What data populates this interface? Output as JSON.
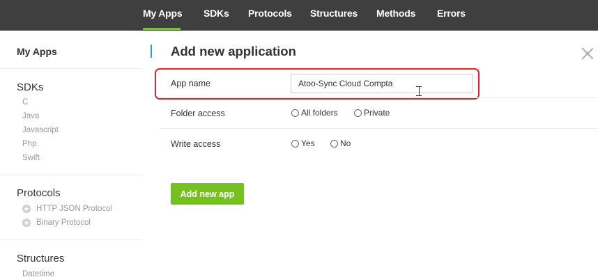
{
  "nav": {
    "items": [
      "My Apps",
      "SDKs",
      "Protocols",
      "Structures",
      "Methods",
      "Errors"
    ],
    "active": "My Apps"
  },
  "sidebar": {
    "my_apps": "My Apps",
    "sdks": {
      "heading": "SDKs",
      "items": [
        "C",
        "Java",
        "Javascript",
        "Php",
        "Swift"
      ]
    },
    "protocols": {
      "heading": "Protocols",
      "items": [
        "HTTP JSON Protocol",
        "Binary Protocol"
      ]
    },
    "structures": {
      "heading": "Structures",
      "items": [
        "Datetime"
      ]
    }
  },
  "form": {
    "title": "Add new application",
    "app_name": {
      "label": "App name",
      "value": "Atoo-Sync Cloud Compta"
    },
    "folder_access": {
      "label": "Folder access",
      "options": [
        "All folders",
        "Private"
      ]
    },
    "write_access": {
      "label": "Write access",
      "options": [
        "Yes",
        "No"
      ]
    },
    "submit_label": "Add new app"
  },
  "colors": {
    "nav_bg": "#3f3f3f",
    "accent_green": "#76c11f",
    "accent_blue": "#2aa0d8",
    "highlight_red": "#e0242a"
  }
}
